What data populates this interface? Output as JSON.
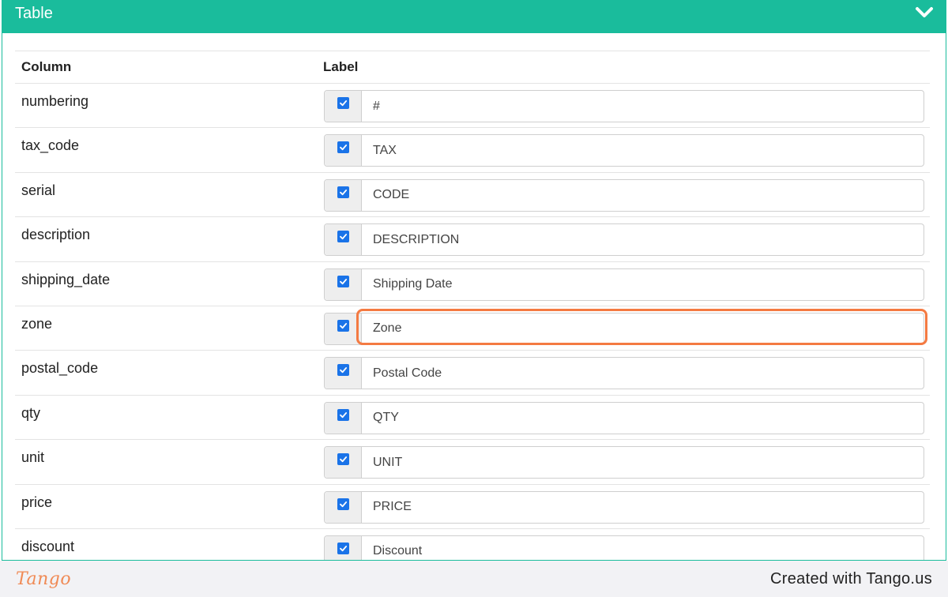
{
  "panel": {
    "title": "Table",
    "toggle_icon": "chevron-down-icon"
  },
  "table": {
    "headers": {
      "column": "Column",
      "label": "Label"
    },
    "rows": [
      {
        "column": "numbering",
        "label": "#",
        "checked": true
      },
      {
        "column": "tax_code",
        "label": "TAX",
        "checked": true
      },
      {
        "column": "serial",
        "label": "CODE",
        "checked": true
      },
      {
        "column": "description",
        "label": "DESCRIPTION",
        "checked": true
      },
      {
        "column": "shipping_date",
        "label": "Shipping Date",
        "checked": true
      },
      {
        "column": "zone",
        "label": "Zone",
        "checked": true,
        "highlighted": true
      },
      {
        "column": "postal_code",
        "label": "Postal Code",
        "checked": true
      },
      {
        "column": "qty",
        "label": "QTY",
        "checked": true
      },
      {
        "column": "unit",
        "label": "UNIT",
        "checked": true
      },
      {
        "column": "price",
        "label": "PRICE",
        "checked": true
      },
      {
        "column": "discount",
        "label": "Discount",
        "checked": true
      }
    ]
  },
  "footer": {
    "logo": "Tango",
    "credit": "Created with Tango.us"
  },
  "colors": {
    "header": "#1abc9c",
    "checkbox": "#1a73e8",
    "highlight": "#f47a42"
  }
}
